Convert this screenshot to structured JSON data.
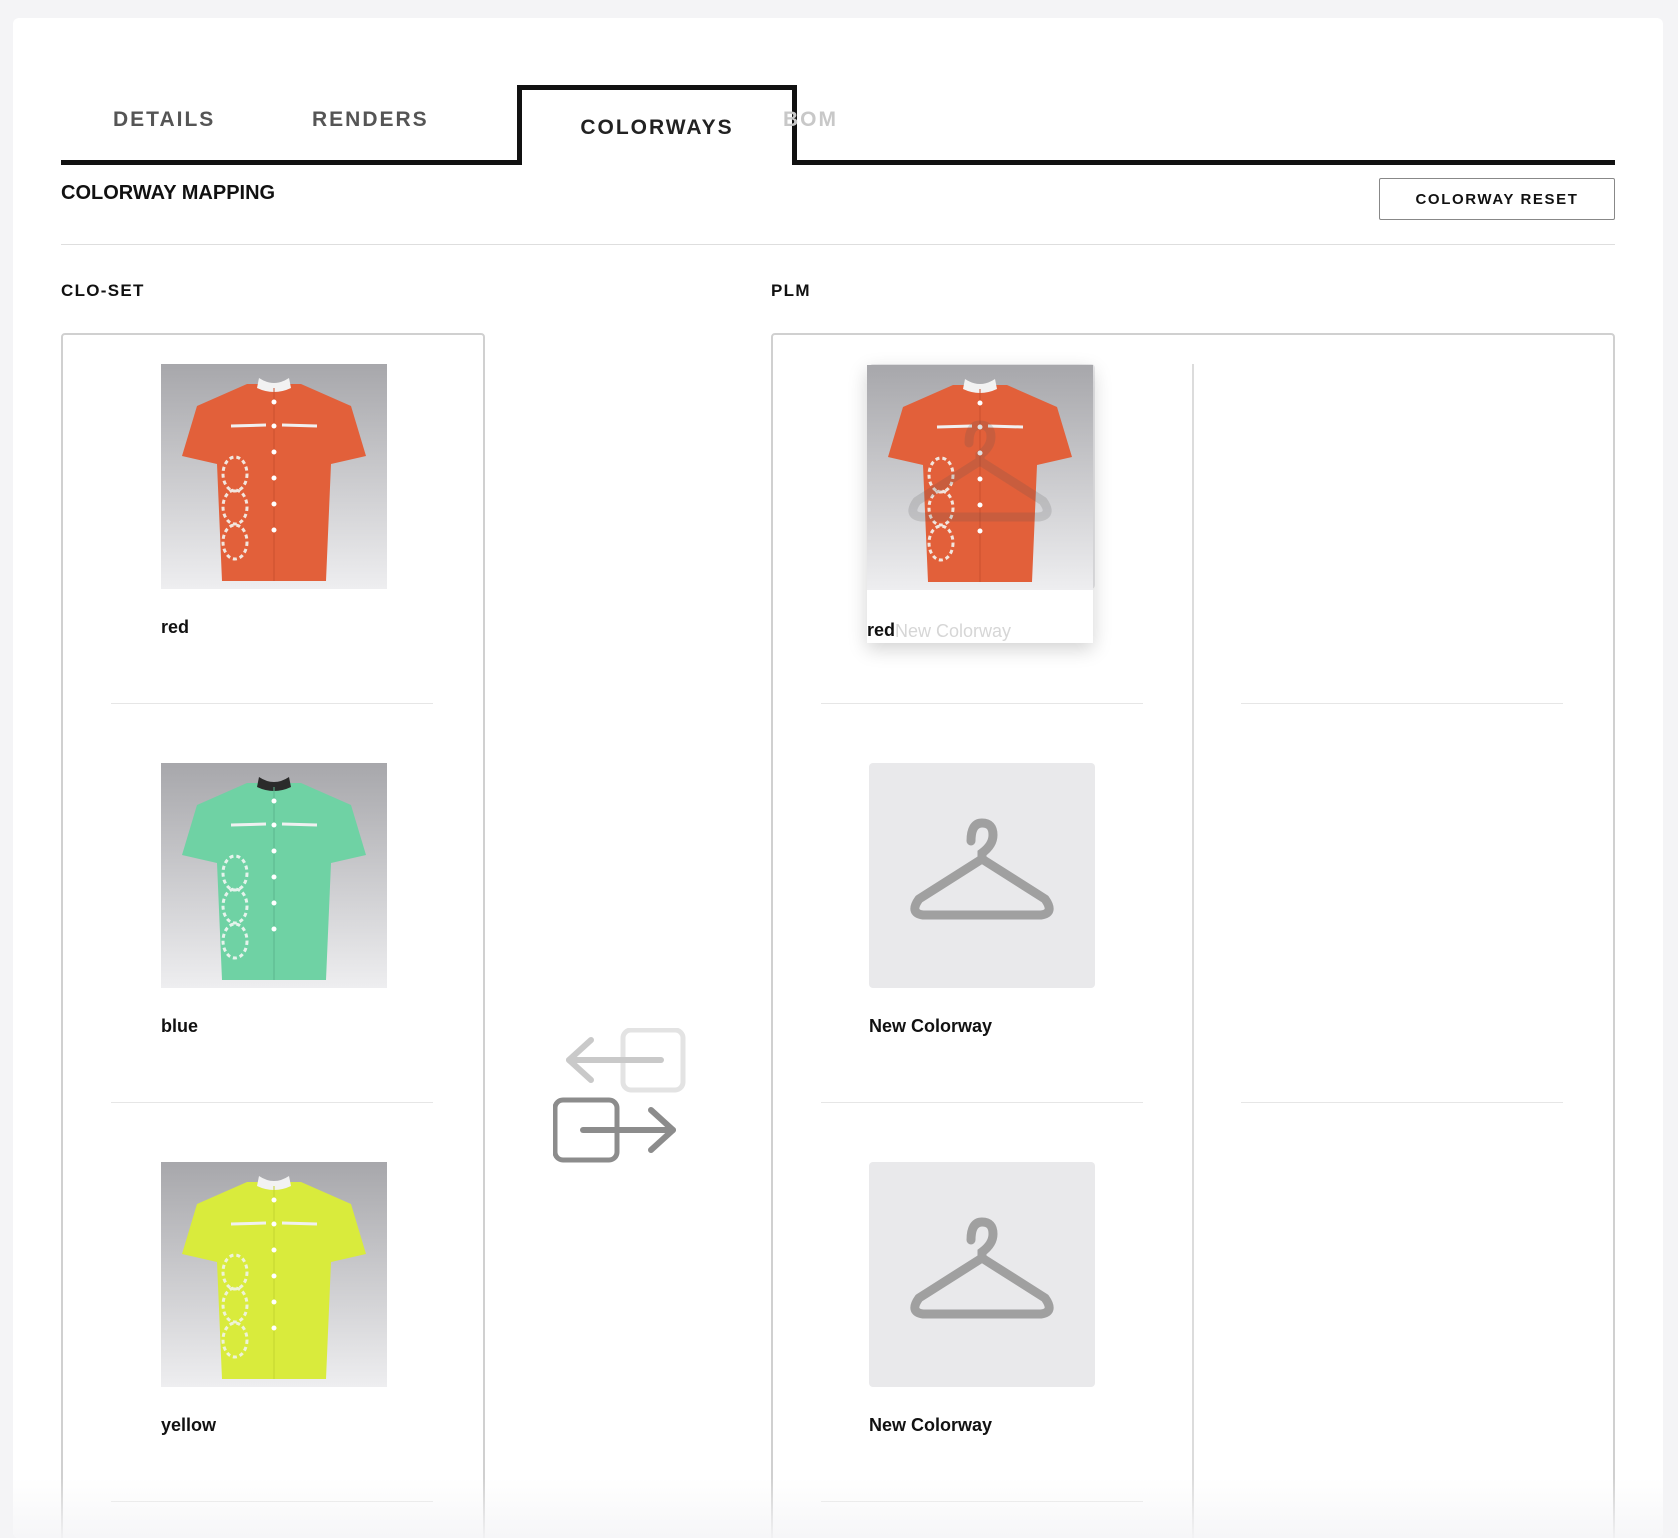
{
  "tabs": [
    {
      "label": "DETAILS",
      "state": "normal"
    },
    {
      "label": "RENDERS",
      "state": "normal"
    },
    {
      "label": "COLORWAYS",
      "state": "active"
    },
    {
      "label": "BOM",
      "state": "disabled"
    }
  ],
  "section": {
    "title": "COLORWAY MAPPING",
    "reset_label": "COLORWAY RESET"
  },
  "clo_set": {
    "label": "CLO-SET",
    "items": [
      {
        "name": "red",
        "color": "#e2603a",
        "collar": "#f2f2f2"
      },
      {
        "name": "blue",
        "color": "#6fd2a4",
        "collar": "#2b2b2b"
      },
      {
        "name": "yellow",
        "color": "#d9eb3c",
        "collar": "#f2f2f2"
      }
    ]
  },
  "plm": {
    "label": "PLM",
    "dragging": {
      "name": "red",
      "ghost_label": "New Colorway",
      "color": "#e2603a"
    },
    "items": [
      {
        "name": "New Colorway"
      },
      {
        "name": "New Colorway"
      }
    ]
  },
  "icons": {
    "swap": "swap-arrows-icon",
    "placeholder": "hanger-icon"
  }
}
